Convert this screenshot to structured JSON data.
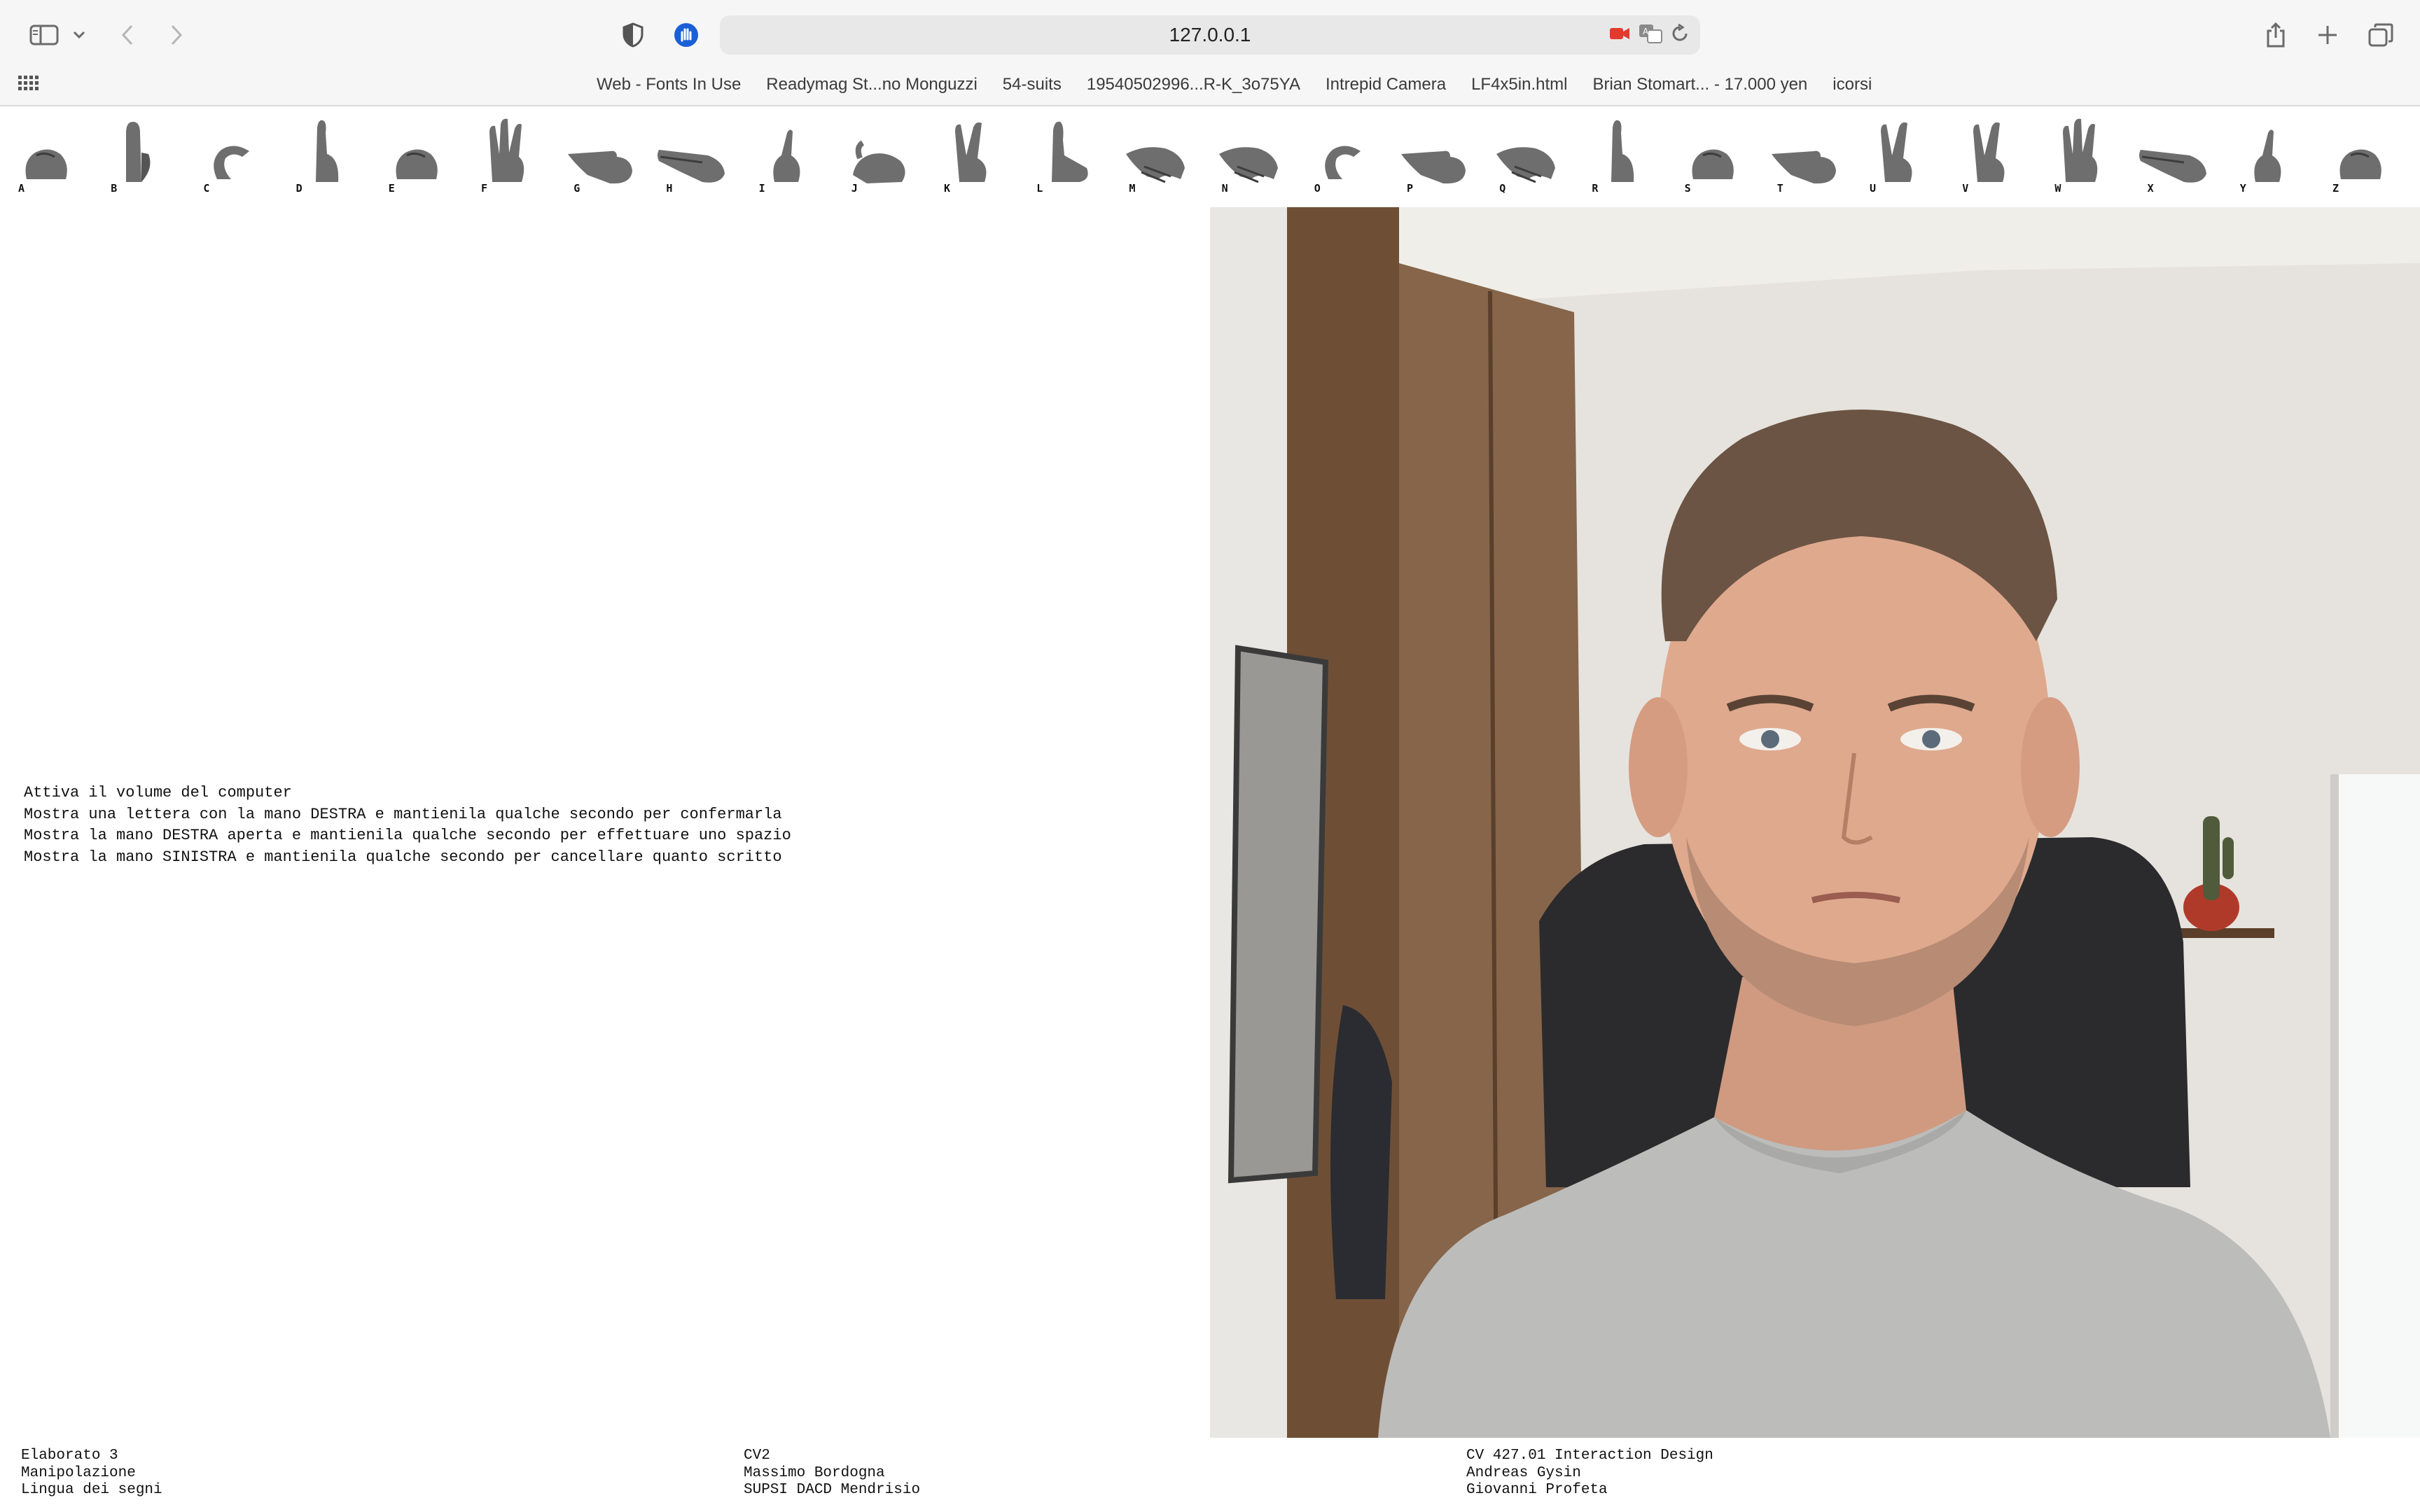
{
  "browser": {
    "url": "127.0.0.1",
    "favorites": [
      "Web - Fonts In Use",
      "Readymag St...no Monguzzi",
      "54-suits",
      "19540502996...R-K_3o75YA",
      "Intrepid Camera",
      "LF4x5in.html",
      "Brian Stomart... - 17.000 yen",
      "icorsi"
    ]
  },
  "alphabet": [
    {
      "letter": "A",
      "shape": "fist"
    },
    {
      "letter": "B",
      "shape": "flat-up"
    },
    {
      "letter": "C",
      "shape": "curve"
    },
    {
      "letter": "D",
      "shape": "point-up"
    },
    {
      "letter": "E",
      "shape": "fist"
    },
    {
      "letter": "F",
      "shape": "three-up"
    },
    {
      "letter": "G",
      "shape": "point-side"
    },
    {
      "letter": "H",
      "shape": "two-side"
    },
    {
      "letter": "I",
      "shape": "pinky"
    },
    {
      "letter": "J",
      "shape": "pinky-curve"
    },
    {
      "letter": "K",
      "shape": "two-up"
    },
    {
      "letter": "L",
      "shape": "l-shape"
    },
    {
      "letter": "M",
      "shape": "down"
    },
    {
      "letter": "N",
      "shape": "down"
    },
    {
      "letter": "O",
      "shape": "curve"
    },
    {
      "letter": "P",
      "shape": "point-side"
    },
    {
      "letter": "Q",
      "shape": "down"
    },
    {
      "letter": "R",
      "shape": "point-up"
    },
    {
      "letter": "S",
      "shape": "fist"
    },
    {
      "letter": "T",
      "shape": "point-side"
    },
    {
      "letter": "U",
      "shape": "two-up"
    },
    {
      "letter": "V",
      "shape": "two-up"
    },
    {
      "letter": "W",
      "shape": "three-up"
    },
    {
      "letter": "X",
      "shape": "two-side"
    },
    {
      "letter": "Y",
      "shape": "pinky"
    },
    {
      "letter": "Z",
      "shape": "fist"
    }
  ],
  "instructions": [
    "Attiva il volume del computer",
    "Mostra una lettera con la mano DESTRA e mantienila qualche secondo per confermarla",
    "Mostra la mano DESTRA aperta e mantienila qualche secondo per effettuare uno spazio",
    "Mostra la mano SINISTRA e mantienila qualche secondo per cancellare quanto scritto"
  ],
  "footer": {
    "col1": [
      "Elaborato 3",
      "Manipolazione",
      "Lingua dei segni"
    ],
    "col2": [
      "CV2",
      "Massimo Bordogna",
      "SUPSI DACD Mendrisio"
    ],
    "col3": [
      "CV 427.01 Interaction Design",
      "Andreas Gysin",
      "Giovanni Profeta"
    ]
  },
  "camera": {
    "subject": "webcam-feed",
    "colors": {
      "wall": "#e4e1dc",
      "wardrobe": "#7a5a40",
      "shirt": "#b9b9b7",
      "skin": "#d9a58c",
      "hair": "#6b5442",
      "chair": "#2a2a2c"
    }
  }
}
